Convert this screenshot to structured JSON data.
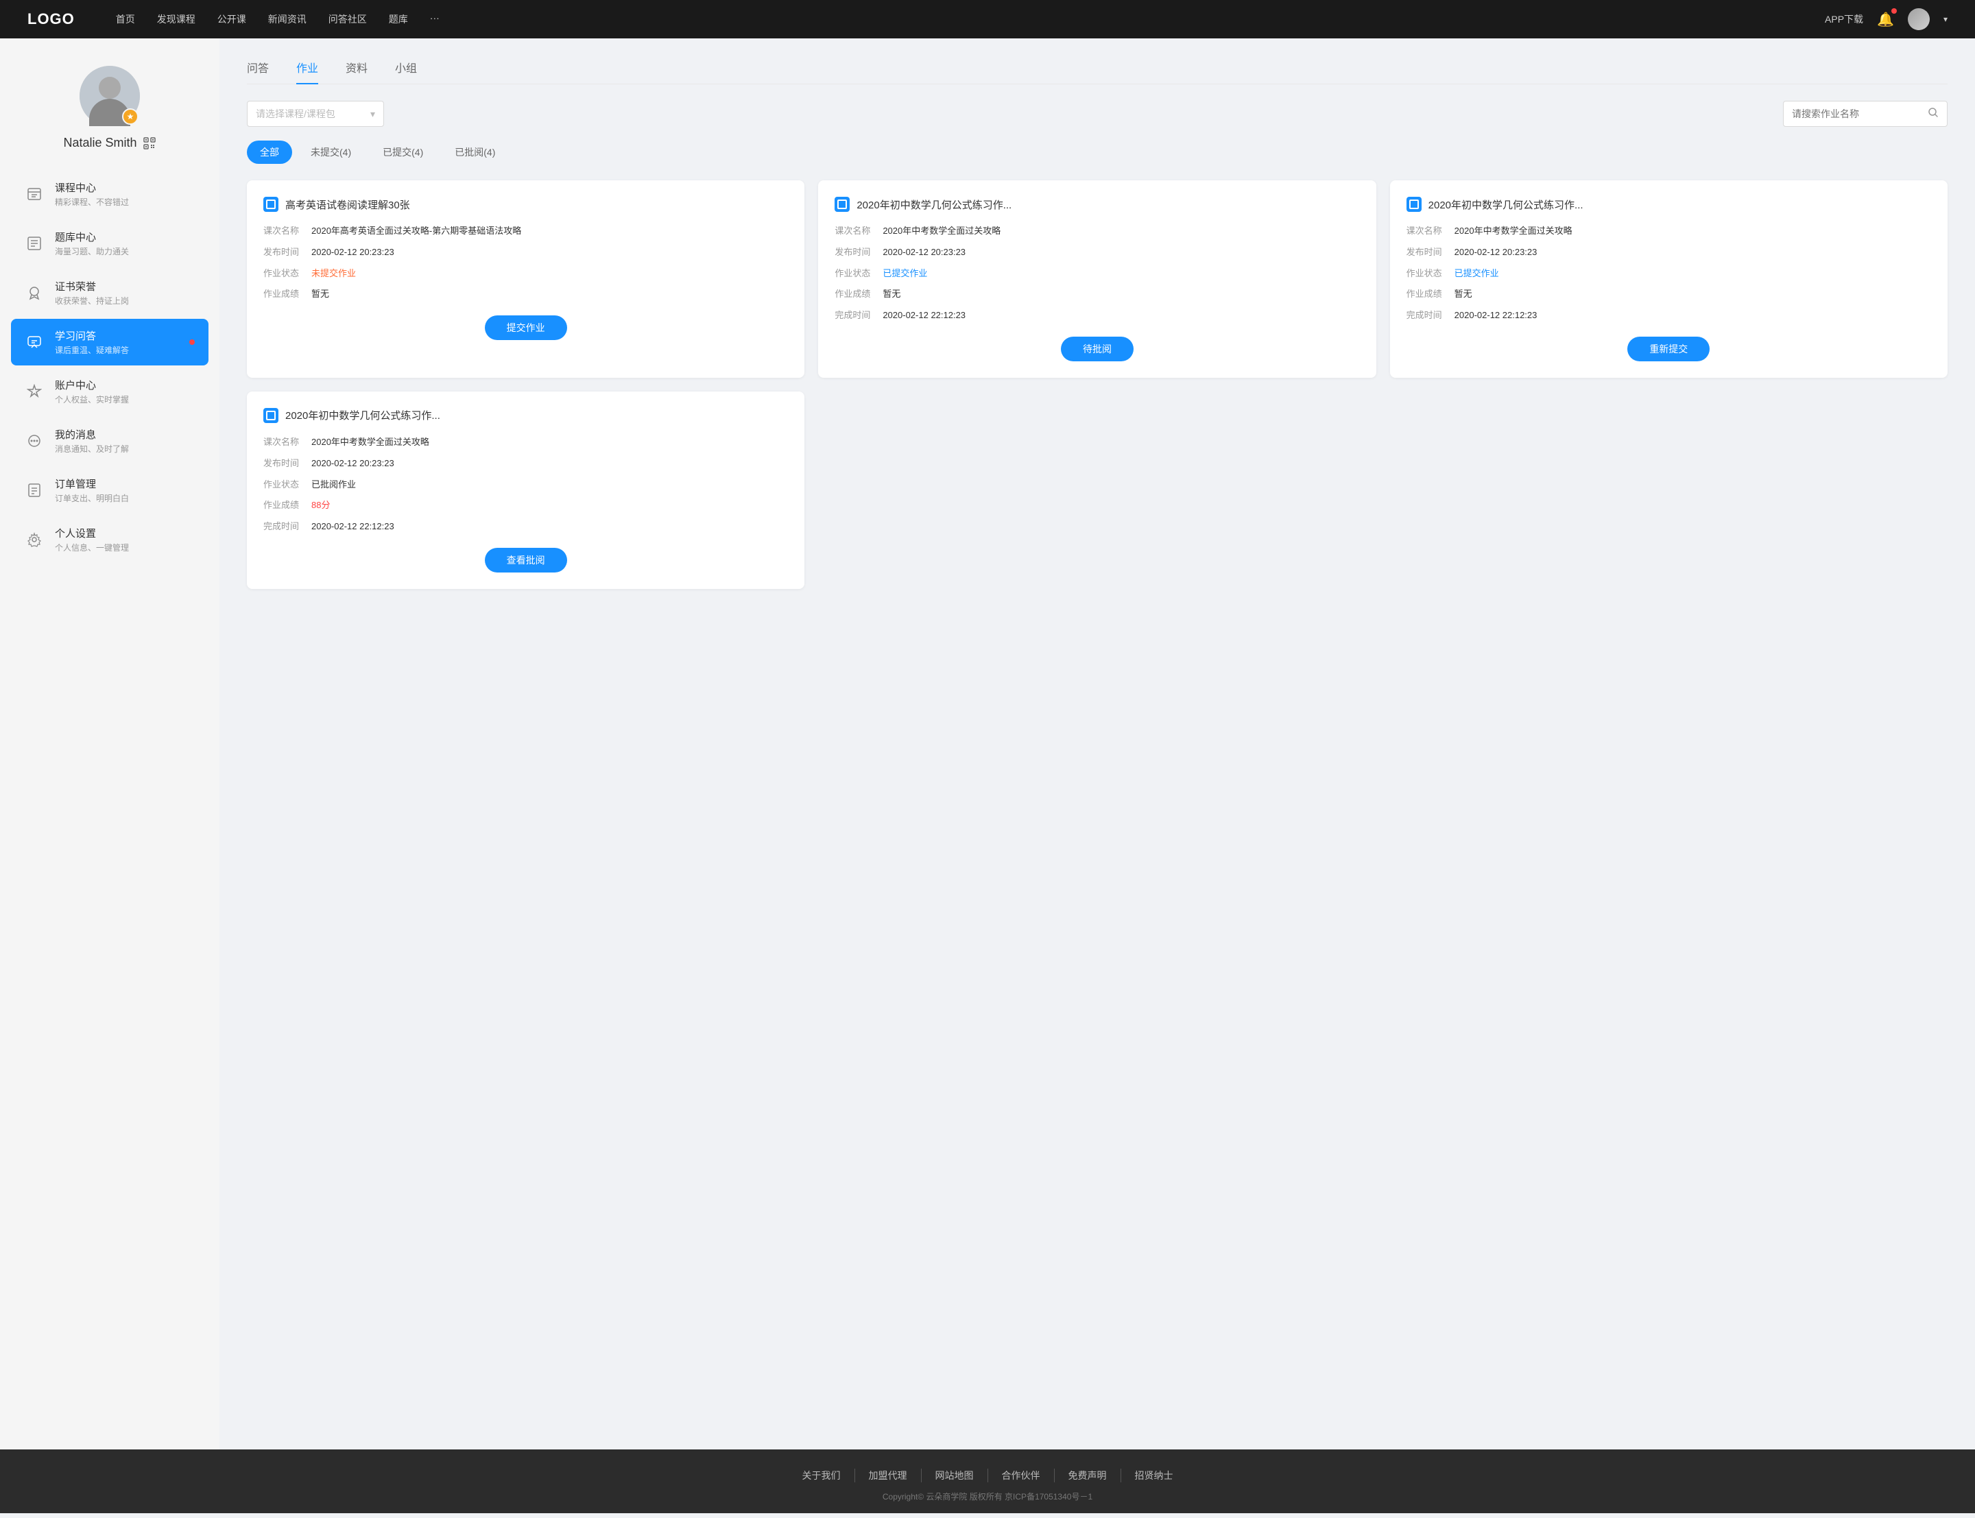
{
  "topnav": {
    "logo": "LOGO",
    "menu": [
      {
        "label": "首页",
        "id": "home"
      },
      {
        "label": "发现课程",
        "id": "discover"
      },
      {
        "label": "公开课",
        "id": "open"
      },
      {
        "label": "新闻资讯",
        "id": "news"
      },
      {
        "label": "问答社区",
        "id": "qa"
      },
      {
        "label": "题库",
        "id": "bank"
      },
      {
        "label": "···",
        "id": "more"
      }
    ],
    "download": "APP下载",
    "arrow": "▾"
  },
  "sidebar": {
    "username": "Natalie Smith",
    "avatar_badge": "★",
    "menu": [
      {
        "id": "course-center",
        "title": "课程中心",
        "sub": "精彩课程、不容错过",
        "icon": "📋",
        "active": false
      },
      {
        "id": "question-bank",
        "title": "题库中心",
        "sub": "海量习题、助力通关",
        "icon": "📝",
        "active": false
      },
      {
        "id": "certificate",
        "title": "证书荣誉",
        "sub": "收获荣誉、持证上岗",
        "icon": "🎖️",
        "active": false
      },
      {
        "id": "learning-qa",
        "title": "学习问答",
        "sub": "课后重温、疑难解答",
        "icon": "💬",
        "active": true,
        "dot": true
      },
      {
        "id": "account-center",
        "title": "账户中心",
        "sub": "个人权益、实时掌握",
        "icon": "💎",
        "active": false
      },
      {
        "id": "messages",
        "title": "我的消息",
        "sub": "消息通知、及时了解",
        "icon": "💬",
        "active": false
      },
      {
        "id": "orders",
        "title": "订单管理",
        "sub": "订单支出、明明白白",
        "icon": "📄",
        "active": false
      },
      {
        "id": "settings",
        "title": "个人设置",
        "sub": "个人信息、一键管理",
        "icon": "⚙️",
        "active": false
      }
    ]
  },
  "main": {
    "tabs": [
      {
        "label": "问答",
        "id": "wenda",
        "active": false
      },
      {
        "label": "作业",
        "id": "zuoye",
        "active": true
      },
      {
        "label": "资料",
        "id": "ziliao",
        "active": false
      },
      {
        "label": "小组",
        "id": "xiaozu",
        "active": false
      }
    ],
    "course_select_placeholder": "请选择课程/课程包",
    "search_placeholder": "请搜索作业名称",
    "status_tabs": [
      {
        "label": "全部",
        "id": "all",
        "active": true
      },
      {
        "label": "未提交(4)",
        "id": "not-submitted",
        "active": false
      },
      {
        "label": "已提交(4)",
        "id": "submitted",
        "active": false
      },
      {
        "label": "已批阅(4)",
        "id": "reviewed",
        "active": false
      }
    ],
    "homework_cards": [
      {
        "id": "hw1",
        "title": "高考英语试卷阅读理解30张",
        "course_label": "课次名称",
        "course_value": "2020年高考英语全面过关攻略-第六期零基础语法攻略",
        "publish_label": "发布时间",
        "publish_value": "2020-02-12 20:23:23",
        "status_label": "作业状态",
        "status_value": "未提交作业",
        "status_type": "not-submitted",
        "score_label": "作业成绩",
        "score_value": "暂无",
        "complete_label": "",
        "complete_value": "",
        "btn_label": "提交作业",
        "show_complete": false
      },
      {
        "id": "hw2",
        "title": "2020年初中数学几何公式练习作...",
        "course_label": "课次名称",
        "course_value": "2020年中考数学全面过关攻略",
        "publish_label": "发布时间",
        "publish_value": "2020-02-12 20:23:23",
        "status_label": "作业状态",
        "status_value": "已提交作业",
        "status_type": "submitted",
        "score_label": "作业成绩",
        "score_value": "暂无",
        "complete_label": "完成时间",
        "complete_value": "2020-02-12 22:12:23",
        "btn_label": "待批阅",
        "show_complete": true
      },
      {
        "id": "hw3",
        "title": "2020年初中数学几何公式练习作...",
        "course_label": "课次名称",
        "course_value": "2020年中考数学全面过关攻略",
        "publish_label": "发布时间",
        "publish_value": "2020-02-12 20:23:23",
        "status_label": "作业状态",
        "status_value": "已提交作业",
        "status_type": "submitted",
        "score_label": "作业成绩",
        "score_value": "暂无",
        "complete_label": "完成时间",
        "complete_value": "2020-02-12 22:12:23",
        "btn_label": "重新提交",
        "show_complete": true
      },
      {
        "id": "hw4",
        "title": "2020年初中数学几何公式练习作...",
        "course_label": "课次名称",
        "course_value": "2020年中考数学全面过关攻略",
        "publish_label": "发布时间",
        "publish_value": "2020-02-12 20:23:23",
        "status_label": "作业状态",
        "status_value": "已批阅作业",
        "status_type": "reviewed",
        "score_label": "作业成绩",
        "score_value": "88分",
        "score_type": "score-red",
        "complete_label": "完成时间",
        "complete_value": "2020-02-12 22:12:23",
        "btn_label": "查看批阅",
        "show_complete": true
      }
    ]
  },
  "footer": {
    "links": [
      {
        "label": "关于我们"
      },
      {
        "label": "加盟代理"
      },
      {
        "label": "网站地图"
      },
      {
        "label": "合作伙伴"
      },
      {
        "label": "免费声明"
      },
      {
        "label": "招贤纳士"
      }
    ],
    "copyright": "Copyright© 云朵商学院  版权所有    京ICP备17051340号－1"
  }
}
